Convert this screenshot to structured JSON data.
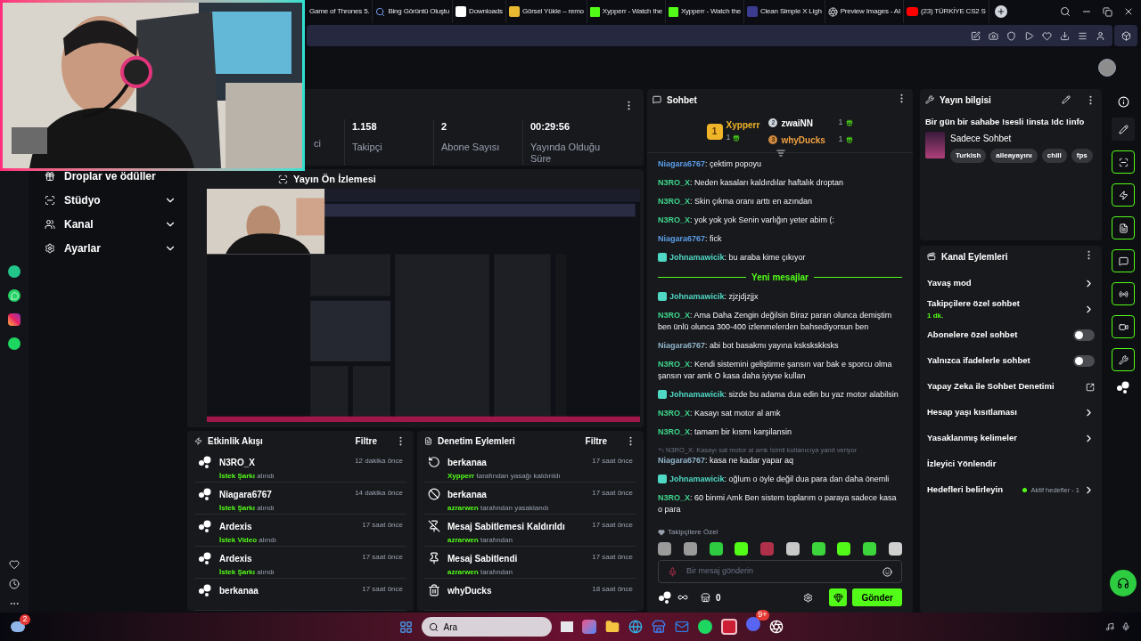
{
  "browser_tabs": [
    {
      "label": "Game of Thrones 5."
    },
    {
      "label": "Bing Görüntü Oluştu"
    },
    {
      "label": "Downloads"
    },
    {
      "label": "Görsel Yükle – remo"
    },
    {
      "label": "Xypperr - Watch the"
    },
    {
      "label": "Xypperr - Watch the"
    },
    {
      "label": "Clean Simple X Ligh"
    },
    {
      "label": "Preview Images - AI"
    },
    {
      "label": "(23) TÜRKİYE CS2 S"
    }
  ],
  "sidebar": {
    "items": [
      {
        "label": "Droplar ve ödüller",
        "expandable": false,
        "expanded": false
      },
      {
        "label": "Stüdyo",
        "expandable": true,
        "expanded": false
      },
      {
        "label": "Kanal",
        "expandable": true,
        "expanded": false
      },
      {
        "label": "Ayarlar",
        "expandable": true,
        "expanded": false
      }
    ]
  },
  "stats": [
    {
      "label": "ci"
    },
    {
      "value": "1.158",
      "label": "Takipçi"
    },
    {
      "value": "2",
      "label": "Abone Sayısı"
    },
    {
      "value": "00:29:56",
      "label": "Yayında Olduğu Süre"
    }
  ],
  "preview": {
    "title": "Yayın Ön İzlemesi",
    "kind": "picture"
  },
  "activity": {
    "title": "Etkinlik Akışı",
    "filter": "Filtre",
    "items": [
      {
        "name": "N3RO_X",
        "reward": "İstek Şarkı",
        "suffix": "alındı",
        "time": "12 dakika önce"
      },
      {
        "name": "Niagara6767",
        "reward": "İstek Şarkı",
        "suffix": "alındı",
        "time": "14 dakika önce"
      },
      {
        "name": "Ardexis",
        "reward": "İstek Video",
        "suffix": "alındı",
        "time": "17 saat önce"
      },
      {
        "name": "Ardexis",
        "reward": "İstek Şarkı",
        "suffix": "alındı",
        "time": "17 saat önce"
      },
      {
        "name": "berkanaa",
        "time": "17 saat önce"
      }
    ]
  },
  "moderation": {
    "title": "Denetim Eylemleri",
    "filter": "Filtre",
    "items": [
      {
        "kind": "unban",
        "title": "berkanaa",
        "actor": "Xypperr",
        "text": "tarafından yasağı kaldırıldı",
        "time": "17 saat önce"
      },
      {
        "kind": "ban",
        "title": "berkanaa",
        "actor": "azrarwen",
        "text": "tarafından yasaklandı",
        "time": "17 saat önce"
      },
      {
        "kind": "unpin",
        "title": "Mesaj Sabitlemesi Kaldırıldı",
        "actor": "azrarwen",
        "text": "tarafından",
        "time": "17 saat önce"
      },
      {
        "kind": "pin",
        "title": "Mesaj Sabitlendi",
        "actor": "azrarwen",
        "text": "tarafından",
        "time": "17 saat önce"
      },
      {
        "kind": "delete",
        "title": "whyDucks",
        "time": "18 saat önce"
      }
    ]
  },
  "chat": {
    "title": "Sohbet",
    "leaders": [
      {
        "rank": "1",
        "name": "Xypperr",
        "count": "1"
      },
      {
        "rank": "2",
        "name": "zwaiNN",
        "count": "1"
      },
      {
        "rank": "3",
        "name": "whyDucks",
        "count": "1"
      }
    ],
    "messages": [
      {
        "user": "Niagara6767",
        "color": "#5b9ee8",
        "badge": false,
        "text": ": çektim popoyu"
      },
      {
        "user": "N3RO_X",
        "color": "#3ed68c",
        "badge": false,
        "text": ": Neden kasaları kaldırdılar haftalık droptan"
      },
      {
        "user": "N3RO_X",
        "color": "#3ed68c",
        "badge": false,
        "text": ": Skin çıkma oranı arttı en azından"
      },
      {
        "user": "N3RO_X",
        "color": "#3ed68c",
        "badge": false,
        "text": ": yok yok yok Senin varlığın yeter abim (:"
      },
      {
        "user": "Niagara6767",
        "color": "#5b9ee8",
        "badge": false,
        "text": ": fick"
      },
      {
        "user": "Johnamawicik",
        "color": "#4fd8c4",
        "badge": true,
        "text": ": bu araba kime çıkıyor"
      },
      {
        "kind": "divider",
        "text": "Yeni mesajlar"
      },
      {
        "user": "Johnamawicik",
        "color": "#4fd8c4",
        "badge": true,
        "text": ": zjzjdjzjjx"
      },
      {
        "user": "N3RO_X",
        "color": "#3ed68c",
        "badge": false,
        "text": ": Ama Daha Zengin değilsin Biraz paran olunca demiştim ben ünlü olunca 300-400 izlenmelerden bahsediyorsun ben"
      },
      {
        "user": "Niagara6767",
        "color": "#8fb3c9",
        "badge": false,
        "text": ": abi bot basakmı yayına kskskskksks"
      },
      {
        "user": "N3RO_X",
        "color": "#3ed68c",
        "badge": false,
        "text": ": Kendi sistemini geliştirme şansın var bak e sporcu olma şansın var amk O kasa daha iyiyse kullan"
      },
      {
        "user": "Johnamawicik",
        "color": "#4fd8c4",
        "badge": true,
        "text": ": sizde bu adama dua edin bu yaz motor alabilsin"
      },
      {
        "user": "N3RO_X",
        "color": "#3ed68c",
        "badge": false,
        "text": ": Kasayı sat motor al amk"
      },
      {
        "user": "N3RO_X",
        "color": "#3ed68c",
        "badge": false,
        "text": ": tamam bir kısmı karşilansin"
      },
      {
        "user": "Niagara6767",
        "color": "#8fb3c9",
        "badge": false,
        "reply": "N3RO_X: Kasayı sat motor al amk İsimli kullanıcıya yanıt veriyor",
        "text": ": kasa ne kadar yapar aq"
      },
      {
        "user": "Johnamawicik",
        "color": "#4fd8c4",
        "badge": true,
        "text": ": oğlum o öyle değil dua para dan daha önemli"
      },
      {
        "user": "N3RO_X",
        "color": "#3ed68c",
        "badge": false,
        "text": ": 60 binmi Amk Ben sistem toplarım o paraya sadece kasa o para"
      }
    ],
    "emote_section": "Takipçilere Özel",
    "input": {
      "placeholder": "Bir mesaj gönderin"
    },
    "store_count": "0",
    "send": "Gönder"
  },
  "stream_info": {
    "title": "Yayın bilgisi",
    "stream_title": "Bir gün bir sahabe !sesli !insta !dc !info",
    "category": "Sadece Sohbet",
    "tags": [
      "Turkish",
      "alleayayını",
      "chill",
      "fps"
    ]
  },
  "channel_actions": {
    "title": "Kanal Eylemleri",
    "items": [
      {
        "kind": "chevron",
        "label": "Yavaş mod"
      },
      {
        "kind": "chevron",
        "label": "Takipçilere özel sohbet",
        "sub": "1 dk."
      },
      {
        "kind": "toggle",
        "label": "Abonelere özel sohbet",
        "on": false
      },
      {
        "kind": "toggle",
        "label": "Yalnızca ifadelerle sohbet",
        "on": false
      },
      {
        "kind": "external",
        "label": "Yapay Zeka ile Sohbet Denetimi"
      },
      {
        "kind": "chevron",
        "label": "Hesap yaşı kısıtlaması"
      },
      {
        "kind": "chevron",
        "label": "Yasaklanmış kelimeler"
      },
      {
        "kind": "plain",
        "label": "İzleyici Yönlendir"
      },
      {
        "kind": "goals",
        "label": "Hedefleri belirleyin",
        "status": "Aktif hedefler - 1"
      }
    ]
  },
  "taskbar": {
    "weather_badge": "2",
    "search": "Ara",
    "discord_badge": "9+"
  }
}
